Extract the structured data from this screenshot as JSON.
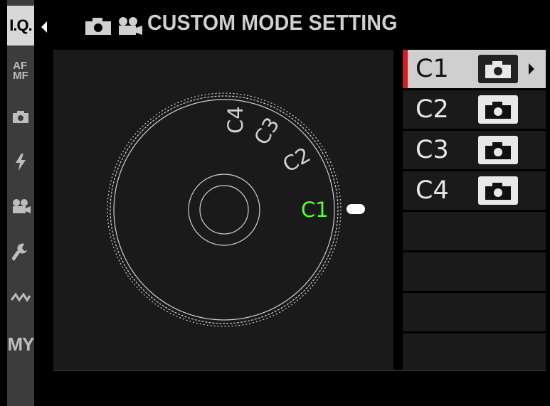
{
  "sidebar": {
    "items": [
      {
        "label": "I.Q.",
        "active": true
      },
      {
        "label": "AF\nMF"
      },
      {
        "label": "",
        "icon": "camera-icon"
      },
      {
        "label": "",
        "icon": "flash-icon"
      },
      {
        "label": "",
        "icon": "movie-icon"
      },
      {
        "label": "",
        "icon": "wrench-icon"
      },
      {
        "label": "",
        "icon": "zigzag-icon"
      },
      {
        "label": "MY"
      }
    ]
  },
  "header": {
    "title": "CUSTOM MODE SETTING"
  },
  "dial": {
    "positions": [
      "C1",
      "C2",
      "C3",
      "C4"
    ],
    "active": "C1",
    "active_color": "#55ff33"
  },
  "list": {
    "rows": [
      {
        "label": "C1",
        "mode_icon": "camera-icon",
        "selected": true
      },
      {
        "label": "C2",
        "mode_icon": "camera-icon"
      },
      {
        "label": "C3",
        "mode_icon": "camera-icon"
      },
      {
        "label": "C4",
        "mode_icon": "camera-icon"
      }
    ]
  },
  "colors": {
    "accent_red": "#d21f1f",
    "selected_bg": "#cfcfcf"
  }
}
